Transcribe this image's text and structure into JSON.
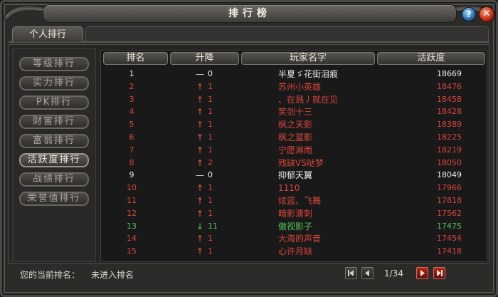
{
  "window": {
    "title": "排行榜"
  },
  "tabs": [
    {
      "label": "个人排行"
    }
  ],
  "sidebar": {
    "items": [
      {
        "label": "等级排行"
      },
      {
        "label": "实力排行"
      },
      {
        "label": "PK排行"
      },
      {
        "label": "财富排行"
      },
      {
        "label": "富翁排行"
      },
      {
        "label": "活跃度排行",
        "active": true
      },
      {
        "label": "战绩排行"
      },
      {
        "label": "荣誉值排行"
      }
    ]
  },
  "table": {
    "headers": {
      "rank": "排名",
      "change": "升降",
      "name": "玩家名字",
      "score": "活跃度"
    },
    "rows": [
      {
        "rank": "1",
        "arrow": "—",
        "delta": "0",
        "name": "半夏ゞ花街泪痕",
        "score": "18669",
        "color": "white"
      },
      {
        "rank": "2",
        "arrow": "↑",
        "delta": "1",
        "name": "苏州小英雄",
        "score": "18476",
        "color": "red"
      },
      {
        "rank": "3",
        "arrow": "↑",
        "delta": "1",
        "name": "、在溅丿就在见",
        "score": "18458",
        "color": "red"
      },
      {
        "rank": "4",
        "arrow": "↑",
        "delta": "1",
        "name": "笑剑十三",
        "score": "18428",
        "color": "red"
      },
      {
        "rank": "5",
        "arrow": "↑",
        "delta": "1",
        "name": "枫之天影",
        "score": "18389",
        "color": "red"
      },
      {
        "rank": "6",
        "arrow": "↑",
        "delta": "1",
        "name": "枫之蓝影",
        "score": "18225",
        "color": "red"
      },
      {
        "rank": "7",
        "arrow": "↑",
        "delta": "1",
        "name": "宁愿淋雨",
        "score": "18219",
        "color": "red"
      },
      {
        "rank": "8",
        "arrow": "↑",
        "delta": "2",
        "name": "残缺VS哒梦",
        "score": "18050",
        "color": "red"
      },
      {
        "rank": "9",
        "arrow": "—",
        "delta": "0",
        "name": "抑郁天翼",
        "score": "18049",
        "color": "white"
      },
      {
        "rank": "10",
        "arrow": "↑",
        "delta": "1",
        "name": "1110",
        "score": "17966",
        "color": "red"
      },
      {
        "rank": "11",
        "arrow": "↑",
        "delta": "1",
        "name": "炫蓝、飞舞",
        "score": "17818",
        "color": "red"
      },
      {
        "rank": "12",
        "arrow": "↑",
        "delta": "1",
        "name": "暗影清刺",
        "score": "17562",
        "color": "red"
      },
      {
        "rank": "13",
        "arrow": "↓",
        "delta": "11",
        "name": "傲视影子",
        "score": "17475",
        "color": "green"
      },
      {
        "rank": "14",
        "arrow": "↑",
        "delta": "1",
        "name": "大海的声音",
        "score": "17454",
        "color": "red"
      },
      {
        "rank": "15",
        "arrow": "↑",
        "delta": "1",
        "name": "心许月缺",
        "score": "17418",
        "color": "red"
      }
    ]
  },
  "status": {
    "label": "您的当前排名：",
    "value": "未进入排名"
  },
  "pagination": {
    "current": "1",
    "total": "34",
    "display": "1/34"
  },
  "icons": {
    "help": "help-icon",
    "close": "close-icon",
    "first": "first-page-icon",
    "prev": "prev-page-icon",
    "next": "next-page-icon",
    "last": "last-page-icon"
  },
  "colors": {
    "up": "#d8453b",
    "down": "#55c25a",
    "same": "#eeeeee"
  }
}
